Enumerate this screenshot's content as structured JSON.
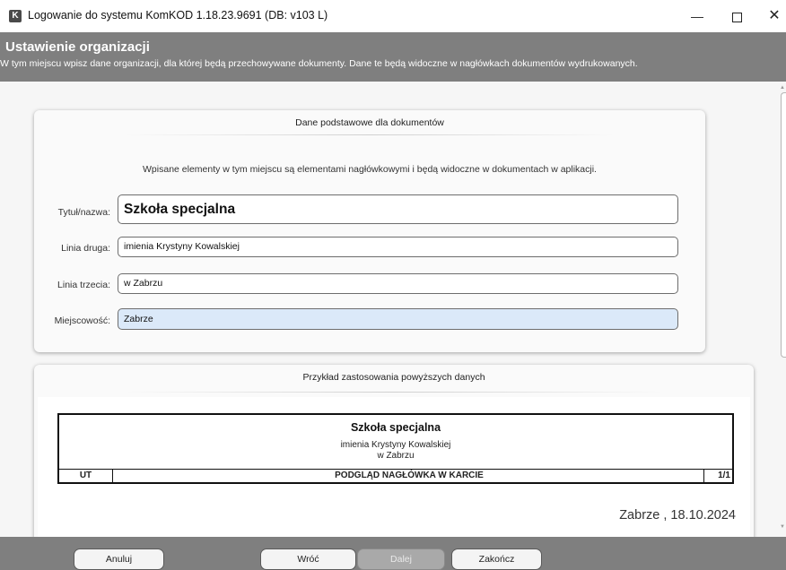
{
  "window": {
    "logo_letter": "K",
    "title": "Logowanie do systemu KomKOD 1.18.23.9691 (DB: v103 L)",
    "minimize": "—",
    "close": "✕"
  },
  "header": {
    "title": "Ustawienie organizacji",
    "description": "W tym miejscu wpisz dane organizacji, dla której będą przechowywane dokumenty. Dane te będą widoczne w nagłówkach dokumentów wydrukowanych."
  },
  "basic_panel": {
    "title": "Dane podstawowe dla dokumentów",
    "note": "Wpisane elementy w tym miejscu są elementami nagłówkowymi i będą widoczne w dokumentach w aplikacji.",
    "fields": {
      "title_label": "Tytuł/nazwa:",
      "title_value": "Szkoła specjalna",
      "line2_label": "Linia druga:",
      "line2_value": "imienia Krystyny Kowalskiej",
      "line3_label": "Linia trzecia:",
      "line3_value": "w Zabrzu",
      "city_label": "Miejscowość:",
      "city_value": "Zabrze"
    }
  },
  "preview_panel": {
    "title": "Przykład zastosowania powyższych danych",
    "header_school": "Szkoła specjalna",
    "header_line2": "imienia Krystyny Kowalskiej",
    "header_line3": "w Zabrzu",
    "header_code": "UT",
    "header_caption": "PODGLĄD NAGŁÓWKA W KARCIE",
    "header_page": "1/1",
    "date_line": "Zabrze , 18.10.2024"
  },
  "buttons": {
    "cancel": "Anuluj",
    "back": "Wróć",
    "next": "Dalej",
    "finish": "Zakończ"
  },
  "colors": {
    "header_bg": "#7f7f7f",
    "focused_field_bg": "#dbe9f9",
    "disabled_button_bg": "#a9a9a9"
  }
}
